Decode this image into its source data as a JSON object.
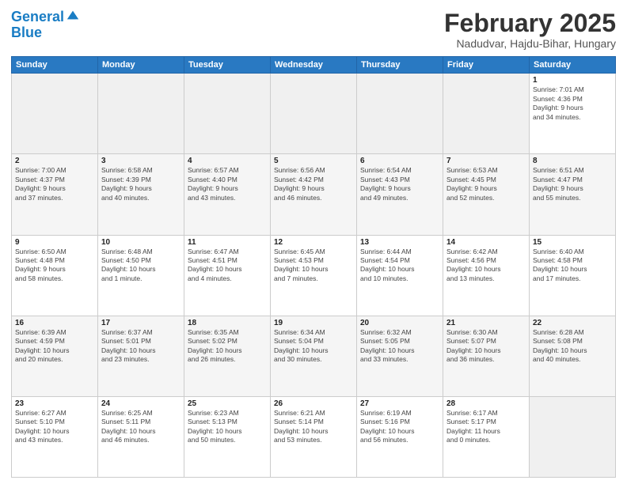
{
  "header": {
    "logo_line1": "General",
    "logo_line2": "Blue",
    "month": "February 2025",
    "location": "Nadudvar, Hajdu-Bihar, Hungary"
  },
  "days_of_week": [
    "Sunday",
    "Monday",
    "Tuesday",
    "Wednesday",
    "Thursday",
    "Friday",
    "Saturday"
  ],
  "weeks": [
    [
      {
        "day": "",
        "info": ""
      },
      {
        "day": "",
        "info": ""
      },
      {
        "day": "",
        "info": ""
      },
      {
        "day": "",
        "info": ""
      },
      {
        "day": "",
        "info": ""
      },
      {
        "day": "",
        "info": ""
      },
      {
        "day": "1",
        "info": "Sunrise: 7:01 AM\nSunset: 4:36 PM\nDaylight: 9 hours\nand 34 minutes."
      }
    ],
    [
      {
        "day": "2",
        "info": "Sunrise: 7:00 AM\nSunset: 4:37 PM\nDaylight: 9 hours\nand 37 minutes."
      },
      {
        "day": "3",
        "info": "Sunrise: 6:58 AM\nSunset: 4:39 PM\nDaylight: 9 hours\nand 40 minutes."
      },
      {
        "day": "4",
        "info": "Sunrise: 6:57 AM\nSunset: 4:40 PM\nDaylight: 9 hours\nand 43 minutes."
      },
      {
        "day": "5",
        "info": "Sunrise: 6:56 AM\nSunset: 4:42 PM\nDaylight: 9 hours\nand 46 minutes."
      },
      {
        "day": "6",
        "info": "Sunrise: 6:54 AM\nSunset: 4:43 PM\nDaylight: 9 hours\nand 49 minutes."
      },
      {
        "day": "7",
        "info": "Sunrise: 6:53 AM\nSunset: 4:45 PM\nDaylight: 9 hours\nand 52 minutes."
      },
      {
        "day": "8",
        "info": "Sunrise: 6:51 AM\nSunset: 4:47 PM\nDaylight: 9 hours\nand 55 minutes."
      }
    ],
    [
      {
        "day": "9",
        "info": "Sunrise: 6:50 AM\nSunset: 4:48 PM\nDaylight: 9 hours\nand 58 minutes."
      },
      {
        "day": "10",
        "info": "Sunrise: 6:48 AM\nSunset: 4:50 PM\nDaylight: 10 hours\nand 1 minute."
      },
      {
        "day": "11",
        "info": "Sunrise: 6:47 AM\nSunset: 4:51 PM\nDaylight: 10 hours\nand 4 minutes."
      },
      {
        "day": "12",
        "info": "Sunrise: 6:45 AM\nSunset: 4:53 PM\nDaylight: 10 hours\nand 7 minutes."
      },
      {
        "day": "13",
        "info": "Sunrise: 6:44 AM\nSunset: 4:54 PM\nDaylight: 10 hours\nand 10 minutes."
      },
      {
        "day": "14",
        "info": "Sunrise: 6:42 AM\nSunset: 4:56 PM\nDaylight: 10 hours\nand 13 minutes."
      },
      {
        "day": "15",
        "info": "Sunrise: 6:40 AM\nSunset: 4:58 PM\nDaylight: 10 hours\nand 17 minutes."
      }
    ],
    [
      {
        "day": "16",
        "info": "Sunrise: 6:39 AM\nSunset: 4:59 PM\nDaylight: 10 hours\nand 20 minutes."
      },
      {
        "day": "17",
        "info": "Sunrise: 6:37 AM\nSunset: 5:01 PM\nDaylight: 10 hours\nand 23 minutes."
      },
      {
        "day": "18",
        "info": "Sunrise: 6:35 AM\nSunset: 5:02 PM\nDaylight: 10 hours\nand 26 minutes."
      },
      {
        "day": "19",
        "info": "Sunrise: 6:34 AM\nSunset: 5:04 PM\nDaylight: 10 hours\nand 30 minutes."
      },
      {
        "day": "20",
        "info": "Sunrise: 6:32 AM\nSunset: 5:05 PM\nDaylight: 10 hours\nand 33 minutes."
      },
      {
        "day": "21",
        "info": "Sunrise: 6:30 AM\nSunset: 5:07 PM\nDaylight: 10 hours\nand 36 minutes."
      },
      {
        "day": "22",
        "info": "Sunrise: 6:28 AM\nSunset: 5:08 PM\nDaylight: 10 hours\nand 40 minutes."
      }
    ],
    [
      {
        "day": "23",
        "info": "Sunrise: 6:27 AM\nSunset: 5:10 PM\nDaylight: 10 hours\nand 43 minutes."
      },
      {
        "day": "24",
        "info": "Sunrise: 6:25 AM\nSunset: 5:11 PM\nDaylight: 10 hours\nand 46 minutes."
      },
      {
        "day": "25",
        "info": "Sunrise: 6:23 AM\nSunset: 5:13 PM\nDaylight: 10 hours\nand 50 minutes."
      },
      {
        "day": "26",
        "info": "Sunrise: 6:21 AM\nSunset: 5:14 PM\nDaylight: 10 hours\nand 53 minutes."
      },
      {
        "day": "27",
        "info": "Sunrise: 6:19 AM\nSunset: 5:16 PM\nDaylight: 10 hours\nand 56 minutes."
      },
      {
        "day": "28",
        "info": "Sunrise: 6:17 AM\nSunset: 5:17 PM\nDaylight: 11 hours\nand 0 minutes."
      },
      {
        "day": "",
        "info": ""
      }
    ]
  ]
}
